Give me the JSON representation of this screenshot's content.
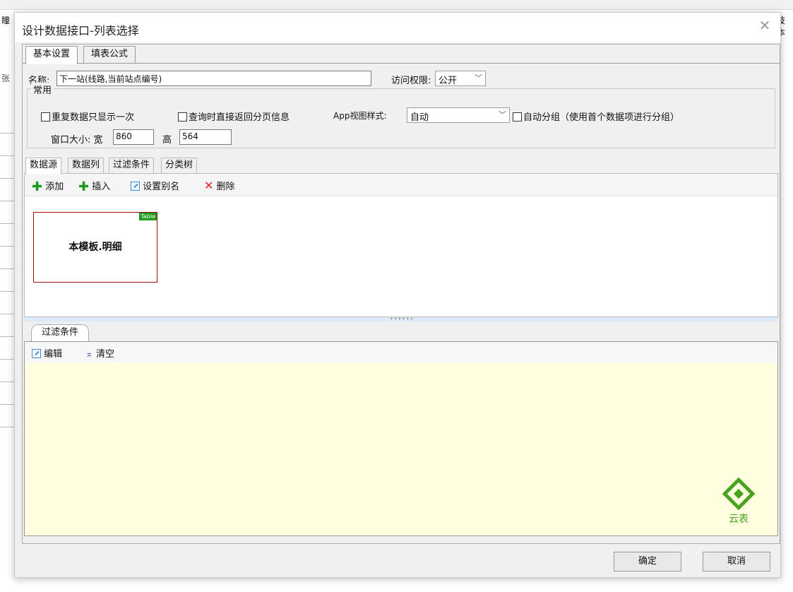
{
  "dialog": {
    "title": "设计数据接口-列表选择",
    "close_glyph": "✕"
  },
  "main_tabs": [
    {
      "label": "基本设置",
      "active": true
    },
    {
      "label": "填表公式",
      "active": false
    }
  ],
  "basic": {
    "name_label": "名称:",
    "name_value": "下一站(线路,当前站点编号)",
    "access_label": "访问权限:",
    "access_value": "公开"
  },
  "common": {
    "group_title": "常用",
    "dedupe_label": "重复数据只显示一次",
    "paging_label": "查询时直接返回分页信息",
    "app_view_label": "App视图样式:",
    "app_view_value": "自动",
    "auto_group_label": "自动分组（使用首个数据项进行分组）",
    "window_size_label": "窗口大小: 宽",
    "width_value": "860",
    "height_label": "高",
    "height_value": "564"
  },
  "sub_tabs": [
    {
      "label": "数据源",
      "active": true
    },
    {
      "label": "数据列",
      "active": false
    },
    {
      "label": "过滤条件",
      "active": false
    },
    {
      "label": "分类树",
      "active": false
    }
  ],
  "datasource_toolbar": {
    "add": "添加",
    "insert": "插入",
    "alias": "设置别名",
    "delete": "删除"
  },
  "card": {
    "badge": "Table",
    "label": "本模板.明细"
  },
  "filter": {
    "tab_label": "过滤条件",
    "edit": "编辑",
    "clear": "清空"
  },
  "logo": {
    "text": "云表",
    "color": "#4aa31f"
  },
  "footer": {
    "ok": "确定",
    "cancel": "取消"
  },
  "background": {
    "left_char": "张",
    "top_left_char": "瞳",
    "right_char": "技本"
  }
}
